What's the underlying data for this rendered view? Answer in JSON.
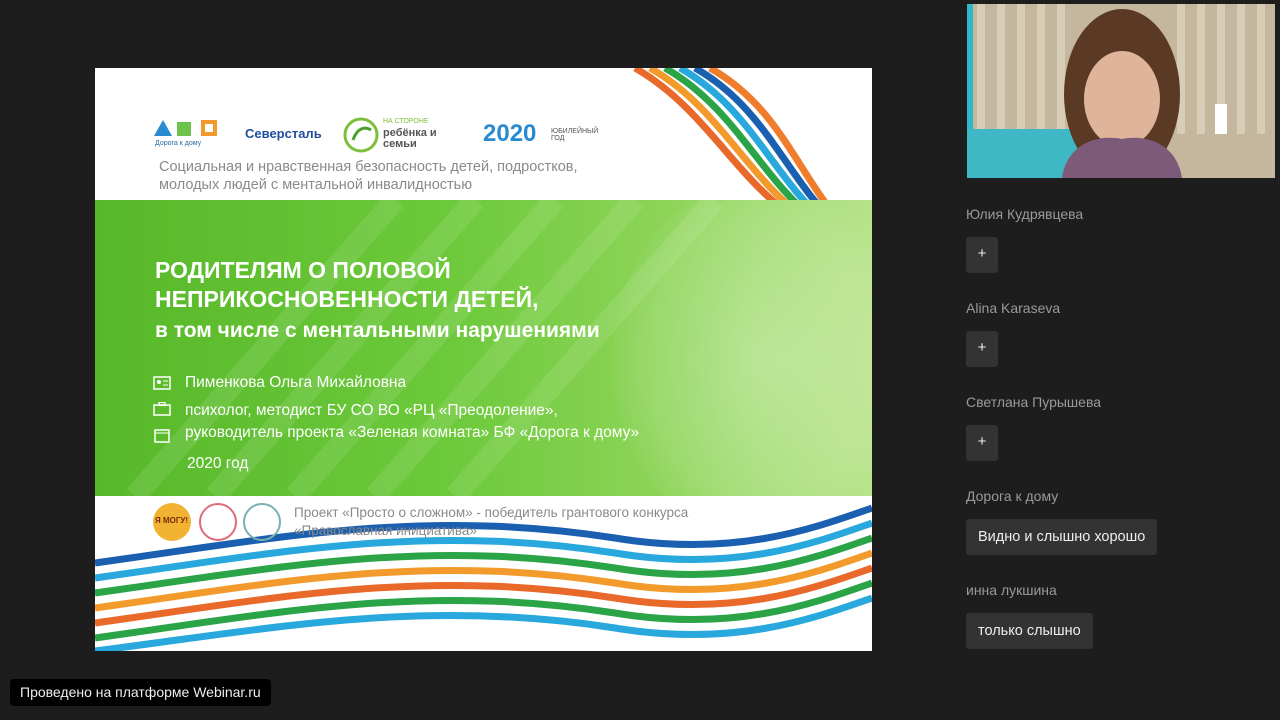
{
  "slide": {
    "logos": {
      "dorogadomu": "Дорога к дому",
      "severstal": "Северсталь",
      "naStorone_top": "НА СТОРОНЕ",
      "naStorone_main": "ребёнка и семьи",
      "jubilee_year": "2020",
      "jubilee_text": "ЮБИЛЕЙНЫЙ ГОД"
    },
    "subtitle": "Социальная и нравственная безопасность детей, подростков, молодых людей с ментальной инвалидностью",
    "title_line1": "РОДИТЕЛЯМ О ПОЛОВОЙ",
    "title_line2": "НЕПРИКОСНОВЕННОСТИ ДЕТЕЙ,",
    "title_line3": "в том числе с ментальными нарушениями",
    "author": "Пименкова Ольга Михайловна",
    "position_line1": "психолог, методист БУ СО ВО «РЦ «Преодоление»,",
    "position_line2": "руководитель проекта «Зеленая комната» БФ «Дорога к дому»",
    "year": "2020 год",
    "footer_line1": "Проект «Просто о сложном» - победитель грантового конкурса",
    "footer_line2": "«Православная инициатива»",
    "partner_logo_text": "Я МОГУ!"
  },
  "participants": [
    {
      "name": "Юлия Кудрявцева",
      "action": "+"
    },
    {
      "name": "Alina Karaseva",
      "action": "+"
    },
    {
      "name": "Светлана Пурышева",
      "action": "+"
    },
    {
      "name": "Дорога к дому",
      "message": "Видно и слышно хорошо"
    },
    {
      "name": "инна лукшина",
      "message": "только слышно"
    }
  ],
  "platform_label": "Проведено на платформе Webinar.ru",
  "colors": {
    "background": "#1d1d1d",
    "slide_green": "#6cc93a",
    "button_bg": "#333333"
  }
}
